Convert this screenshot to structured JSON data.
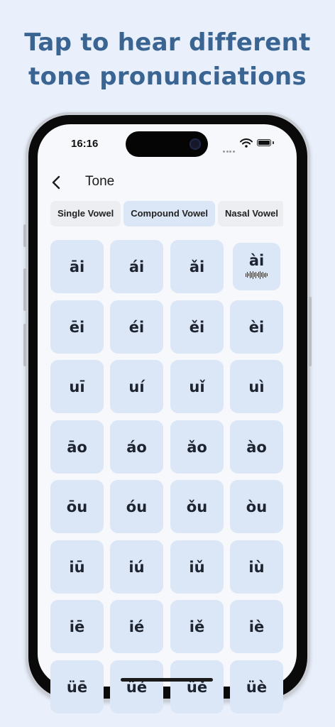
{
  "promo": {
    "line1": "Tap to hear different",
    "line2": "tone pronunciations"
  },
  "status_bar": {
    "time": "16:16",
    "icons": [
      "signal-dots-icon",
      "wifi-icon",
      "battery-icon"
    ]
  },
  "nav": {
    "back_icon": "chevron-left-icon",
    "title": "Tone"
  },
  "tabs": [
    {
      "label": "Single Vowel",
      "active": false
    },
    {
      "label": "Compound Vowel",
      "active": true
    },
    {
      "label": "Nasal Vowel",
      "active": false
    }
  ],
  "syllables": [
    [
      "āi",
      "ái",
      "ǎi",
      "ài"
    ],
    [
      "ēi",
      "éi",
      "ěi",
      "èi"
    ],
    [
      "uī",
      "uí",
      "uǐ",
      "uì"
    ],
    [
      "āo",
      "áo",
      "ǎo",
      "ào"
    ],
    [
      "ōu",
      "óu",
      "ǒu",
      "òu"
    ],
    [
      "iū",
      "iú",
      "iǔ",
      "iù"
    ],
    [
      "iē",
      "ié",
      "iě",
      "iè"
    ],
    [
      "üē",
      "üé",
      "üě",
      "üè"
    ]
  ],
  "playing": "ài",
  "colors": {
    "headline": "#3a6593",
    "cell_bg": "#dbe6f6",
    "tab_inactive": "#eceef1",
    "page_bg": "#e9f0fb"
  }
}
